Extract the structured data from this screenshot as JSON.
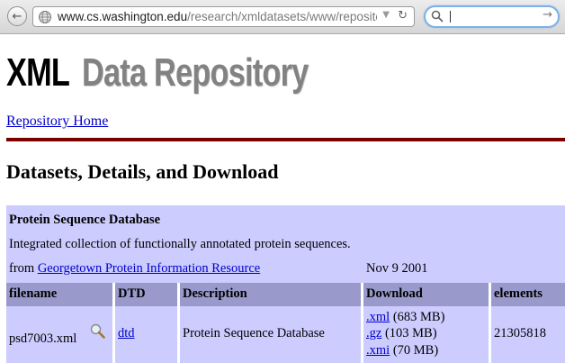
{
  "browser": {
    "url_host": "www.cs.washington.edu",
    "url_path": "/research/xmldatasets/www/reposito",
    "url_scheme": "",
    "search_value": ""
  },
  "page": {
    "logo_xml": "XML",
    "logo_rest": "Data Repository",
    "home_link": "Repository Home",
    "title": "Datasets, Details, and Download"
  },
  "dataset": {
    "name": "Protein Sequence Database",
    "description": "Integrated collection of functionally annotated protein sequences.",
    "from_label": "from",
    "source_link": "Georgetown Protein Information Resource",
    "date": "Nov 9 2001",
    "headers": [
      "filename",
      "DTD",
      "Description",
      "Download",
      "elements"
    ],
    "row": {
      "filename": "psd7003.xml",
      "dtd": "dtd",
      "description": "Protein Sequence Database",
      "downloads": [
        {
          "link": ".xml",
          "size": "(683 MB)"
        },
        {
          "link": ".gz",
          "size": "(103 MB)"
        },
        {
          "link": ".xmi",
          "size": "(70 MB)"
        }
      ],
      "elements": "21305818"
    }
  },
  "colors": {
    "dataset_bg": "#ccccff",
    "header_bg": "#9999cc",
    "rule": "#7a0000",
    "link": "#0000cc"
  },
  "icons": [
    "back-arrow-icon",
    "globe-icon",
    "dropdown-caret-icon",
    "reload-icon",
    "search-icon",
    "search-go-icon",
    "magnifier-icon"
  ]
}
